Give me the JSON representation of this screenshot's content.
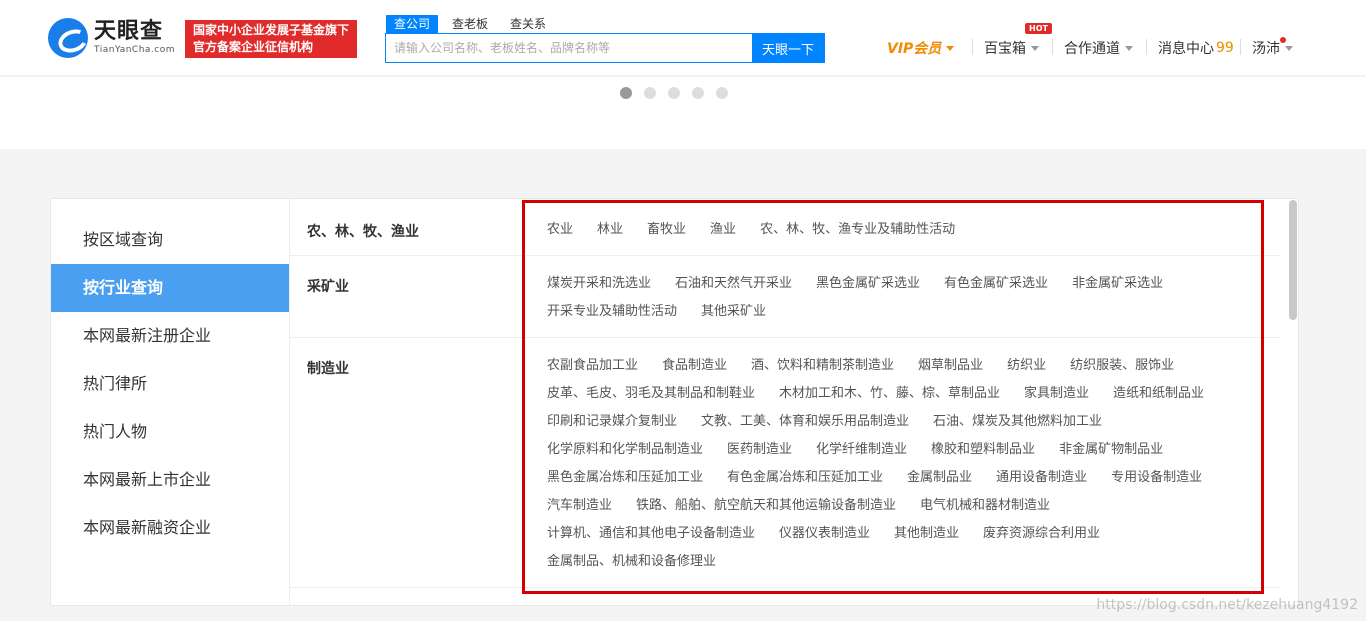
{
  "header": {
    "logo_cn": "天眼查",
    "logo_en": "TianYanCha.com",
    "badge_line1": "国家中小企业发展子基金旗下",
    "badge_line2": "官方备案企业征信机构",
    "search_tabs": [
      "查公司",
      "查老板",
      "查关系"
    ],
    "search_placeholder": "请输入公司名称、老板姓名、品牌名称等",
    "search_button": "天眼一下",
    "vip": "VIP会员",
    "baibaoxiang": "百宝箱",
    "hot": "HOT",
    "cooperation": "合作通道",
    "message_center": "消息中心",
    "message_count": "99",
    "user": "汤沛"
  },
  "sidebar": {
    "items": [
      "按区域查询",
      "按行业查询",
      "本网最新注册企业",
      "热门律所",
      "热门人物",
      "本网最新上市企业",
      "本网最新融资企业"
    ]
  },
  "industries": [
    {
      "title": "农、林、牧、渔业",
      "items": [
        "农业",
        "林业",
        "畜牧业",
        "渔业",
        "农、林、牧、渔专业及辅助性活动"
      ]
    },
    {
      "title": "采矿业",
      "items": [
        "煤炭开采和洗选业",
        "石油和天然气开采业",
        "黑色金属矿采选业",
        "有色金属矿采选业",
        "非金属矿采选业",
        "开采专业及辅助性活动",
        "其他采矿业"
      ]
    },
    {
      "title": "制造业",
      "items": [
        "农副食品加工业",
        "食品制造业",
        "酒、饮料和精制茶制造业",
        "烟草制品业",
        "纺织业",
        "纺织服装、服饰业",
        "皮革、毛皮、羽毛及其制品和制鞋业",
        "木材加工和木、竹、藤、棕、草制品业",
        "家具制造业",
        "造纸和纸制品业",
        "印刷和记录媒介复制业",
        "文教、工美、体育和娱乐用品制造业",
        "石油、煤炭及其他燃料加工业",
        "化学原料和化学制品制造业",
        "医药制造业",
        "化学纤维制造业",
        "橡胶和塑料制品业",
        "非金属矿物制品业",
        "黑色金属冶炼和压延加工业",
        "有色金属冶炼和压延加工业",
        "金属制品业",
        "通用设备制造业",
        "专用设备制造业",
        "汽车制造业",
        "铁路、船舶、航空航天和其他运输设备制造业",
        "电气机械和器材制造业",
        "计算机、通信和其他电子设备制造业",
        "仪器仪表制造业",
        "其他制造业",
        "废弃资源综合利用业",
        "金属制品、机械和设备修理业"
      ]
    }
  ],
  "watermark": "https://blog.csdn.net/kezehuang4192"
}
